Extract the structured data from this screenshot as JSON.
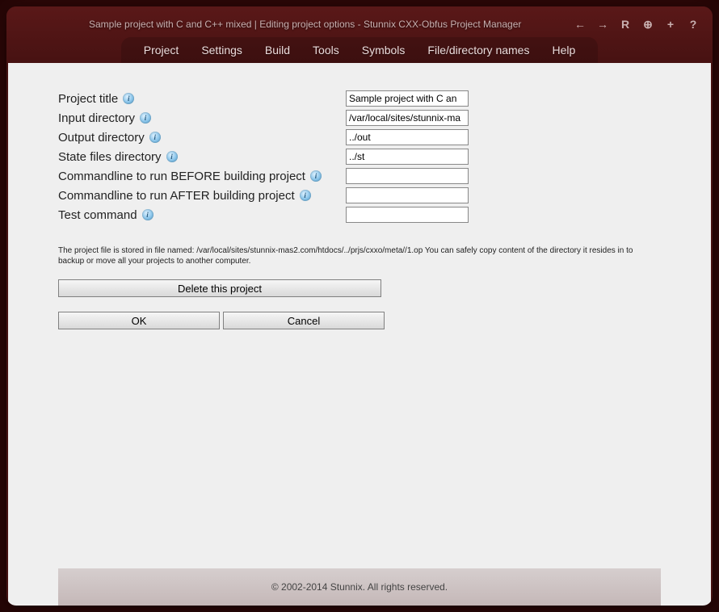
{
  "page_title": "Sample project with C and C++ mixed | Editing project options - Stunnix CXX-Obfus Project Manager",
  "menu": {
    "project": "Project",
    "settings": "Settings",
    "build": "Build",
    "tools": "Tools",
    "symbols": "Symbols",
    "file_dir": "File/directory names",
    "help": "Help"
  },
  "icons": {
    "back": "←",
    "forward": "→",
    "r": "R",
    "circle_plus": "⊕",
    "plus": "+",
    "help": "?"
  },
  "form": {
    "project_title": {
      "label": "Project title",
      "value": "Sample project with C an"
    },
    "input_dir": {
      "label": "Input directory",
      "value": "/var/local/sites/stunnix-ma"
    },
    "output_dir": {
      "label": "Output directory",
      "value": "../out"
    },
    "state_dir": {
      "label": "State files directory",
      "value": "../st"
    },
    "cmd_before": {
      "label": "Commandline to run BEFORE building project",
      "value": ""
    },
    "cmd_after": {
      "label": "Commandline to run AFTER building project",
      "value": ""
    },
    "test_cmd": {
      "label": "Test command",
      "value": ""
    }
  },
  "note": "The project file is stored in file named: /var/local/sites/stunnix-mas2.com/htdocs/../prjs/cxxo/meta//1.op You can safely copy content of the directory it resides in to backup or move all your projects to another computer.",
  "buttons": {
    "delete": "Delete this project",
    "ok": "OK",
    "cancel": "Cancel"
  },
  "footer": "© 2002-2014 Stunnix. All rights reserved."
}
